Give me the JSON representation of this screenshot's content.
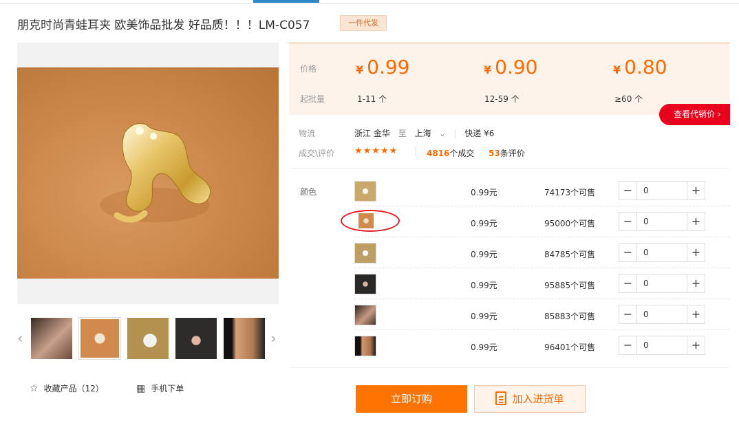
{
  "title": "朋克时尚青蛙耳夹 欧美饰品批发 好品质！！！LM-C057",
  "badge": "一件代发",
  "gallery": {
    "thumbs": [
      "ear-cuff-model",
      "ear-cuff-gold",
      "ear-cuff-silver",
      "ear-cuff-dark",
      "ear-cuff-closeup"
    ]
  },
  "actions": {
    "favorite": "收藏产品（12）",
    "mobile": "手机下单"
  },
  "price": {
    "price_label": "价格",
    "moq_label": "起批量",
    "currency": "¥",
    "tiers": [
      {
        "price": "0.99",
        "range": "1-11 个"
      },
      {
        "price": "0.90",
        "range": "12-59 个"
      },
      {
        "price": "0.80",
        "range": "≥60 个"
      }
    ],
    "agent_button": "查看代销价"
  },
  "shipping": {
    "label": "物流",
    "origin": "浙江 金华",
    "to": "至",
    "destination": "上海",
    "express": "快递 ¥6"
  },
  "deal": {
    "label": "成交\\评价",
    "stars": "★★★★★",
    "deals_count": "4816",
    "deals_suffix": "个成交",
    "reviews_count": "53",
    "reviews_suffix": "条评价"
  },
  "sku": {
    "color_label": "颜色",
    "rows": [
      {
        "price": "0.99元",
        "stock": "74173个可售",
        "qty": "0"
      },
      {
        "price": "0.99元",
        "stock": "95000个可售",
        "qty": "0"
      },
      {
        "price": "0.99元",
        "stock": "84785个可售",
        "qty": "0"
      },
      {
        "price": "0.99元",
        "stock": "95885个可售",
        "qty": "0"
      },
      {
        "price": "0.99元",
        "stock": "85883个可售",
        "qty": "0"
      },
      {
        "price": "0.99元",
        "stock": "96401个可售",
        "qty": "0"
      }
    ]
  },
  "buttons": {
    "buy": "立即订购",
    "cart": "加入进货单"
  },
  "colors": {
    "accent": "#ff6a00",
    "red": "#e8001c"
  }
}
